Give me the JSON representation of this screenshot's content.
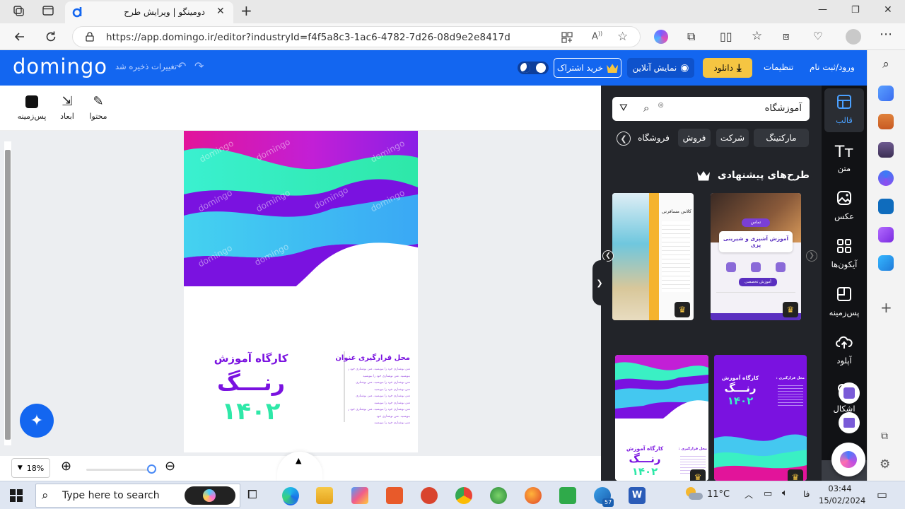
{
  "browser": {
    "tab_title": "دومینگو | ویرایش طرح",
    "url": "https://app.domingo.ir/editor?industryId=f4f5a8c3-1ac6-4782-7d26-08d9e2e8417d",
    "new_tab": "+",
    "minimize": "—",
    "restore": "❐",
    "close": "✕"
  },
  "header": {
    "logo": "domingo",
    "saved_status": "تغییرات ذخیره شد",
    "buy_subscription": "خرید اشتراک",
    "show_online": "نمایش آنلاین",
    "download": "دانلود",
    "settings": "تنظیمات",
    "login": "ورود/ثبت نام"
  },
  "tools": {
    "content": "محتوا",
    "dimensions": "ابعاد",
    "background": "پس‌زمینه"
  },
  "design": {
    "watermark": "domingo",
    "title_top": "کارگاه آموزش",
    "title_main": "رنـــگ",
    "year": "۱۴۰۲",
    "side_heading": "محل قرارگیری عنوان",
    "side_lines": [
      "متن نوشتاری خود را بنویسید. متن نوشتاری خود را",
      "بنویسید. متن نوشتاری خود را بنویسید",
      "متن نوشتاری خود را بنویسید. متن نوشتاری",
      "متن نوشتاری خود را بنویسید",
      "متن نوشتاری خود را بنویسید. متن نوشتاری",
      "متن نوشتاری خود را بنویسید",
      "متن نوشتاری خود را بنویسید. متن نوشتاری خود را",
      "بنویسید. متن نوشتاری خود",
      "متن نوشتاری خود را بنویسید"
    ]
  },
  "zoom": {
    "level": "18%"
  },
  "panel": {
    "search_value": "آموزشگاه",
    "chips": [
      "مارکتینگ",
      "شرکت",
      "فروش",
      "فروشگاه"
    ],
    "suggested_title": "طرح‌های پیشنهادی",
    "card1": {
      "badge": "تماس",
      "title": "آموزش آشپزی و شیرینی پزی",
      "caption": "آموزش تخصصی"
    },
    "card2": {
      "heading": "کلاس مسافرتی"
    },
    "card3": {
      "title_top": "کارگاه آموزش",
      "title_main": "رنـــگ",
      "year": "۱۴۰۲",
      "side_heading": "محل قرارگیری عنوان"
    },
    "card4": {
      "title_top": "کارگاه آموزش",
      "title_main": "رنـــگ",
      "year": "۱۴۰۲",
      "side_heading": "محل قرارگیری عنوان"
    }
  },
  "right_nav": [
    {
      "label": "قالب",
      "icon": "template-icon"
    },
    {
      "label": "متن",
      "icon": "text-icon"
    },
    {
      "label": "عکس",
      "icon": "image-icon"
    },
    {
      "label": "آیکون‌ها",
      "icon": "icons-grid-icon"
    },
    {
      "label": "پس‌زمینه",
      "icon": "background-icon"
    },
    {
      "label": "آپلود",
      "icon": "upload-icon"
    },
    {
      "label": "اشکال",
      "icon": "shapes-icon"
    }
  ],
  "taskbar": {
    "search_placeholder": "Type here to search",
    "temperature": "11°C",
    "lang": "فا",
    "time": "03:44",
    "date": "15/02/2024",
    "badge": "57"
  },
  "colors": {
    "brand_blue": "#1366f0",
    "purple": "#7a12e0",
    "teal": "#2ee8c4",
    "magenta": "#e2149a",
    "download_yellow": "#f5c542",
    "panel_dark": "#222429"
  }
}
